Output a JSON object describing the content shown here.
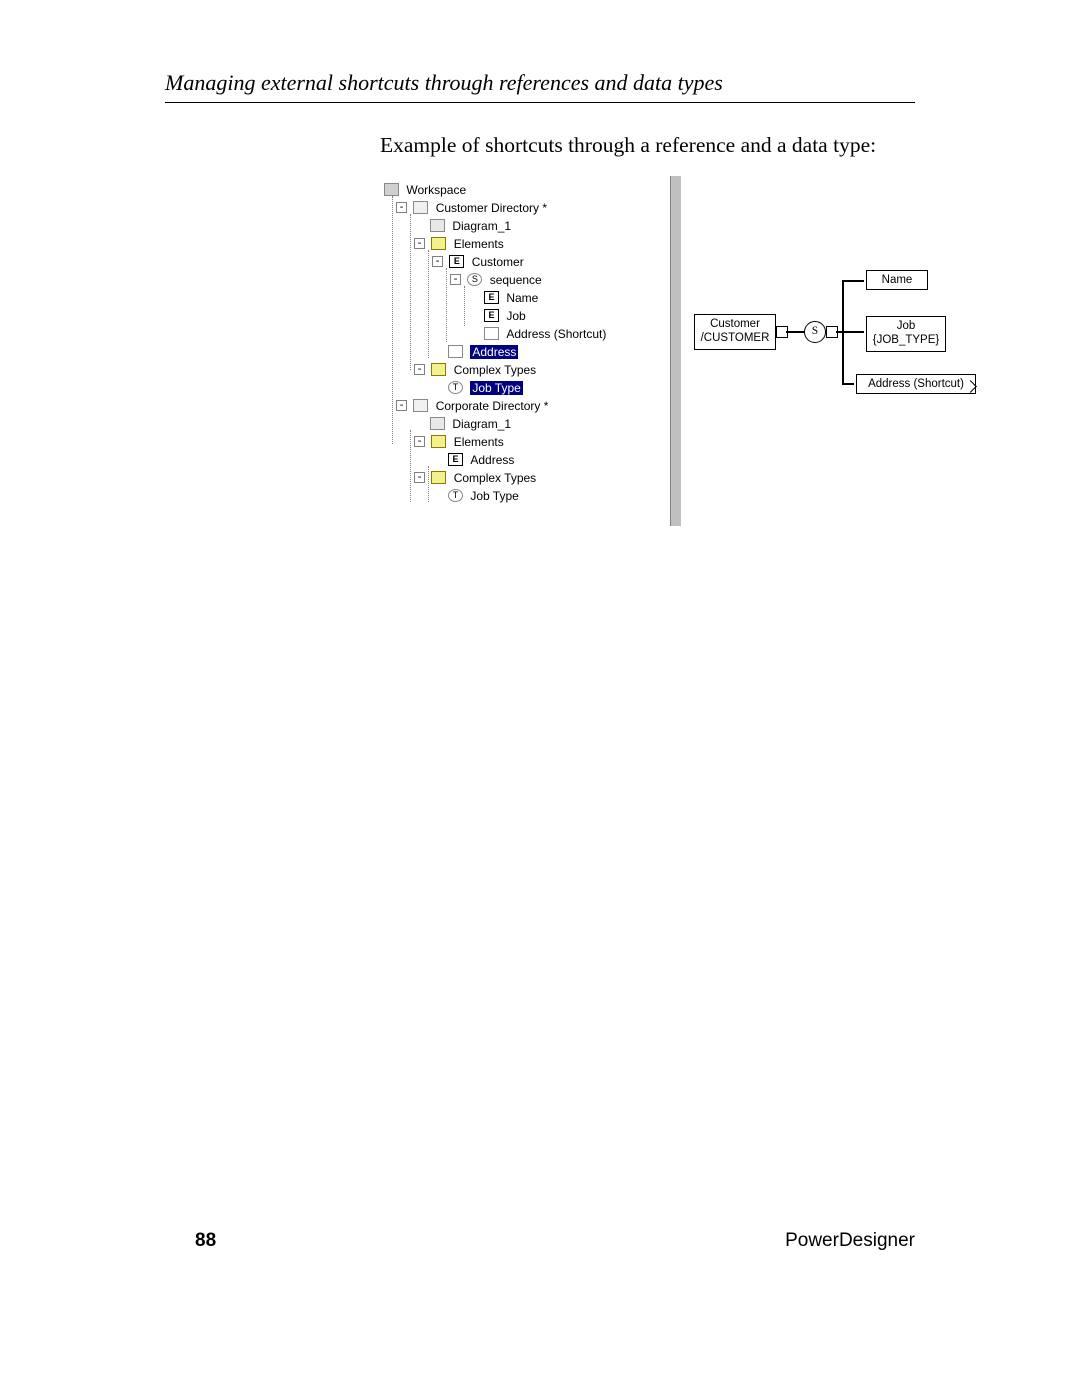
{
  "heading": "Managing external shortcuts through references and data types",
  "example_text": "Example of shortcuts through a reference and a data type:",
  "tree": {
    "workspace": "Workspace",
    "cust_dir": "Customer Directory *",
    "diagram1_a": "Diagram_1",
    "elements_a": "Elements",
    "customer": "Customer",
    "sequence": "sequence",
    "name": "Name",
    "job": "Job",
    "address_sc": "Address (Shortcut)",
    "address_sel": "Address",
    "complex_a": "Complex Types",
    "jobtype_sel": "Job Type",
    "corp_dir": "Corporate Directory *",
    "diagram1_b": "Diagram_1",
    "elements_b": "Elements",
    "address_b": "Address",
    "complex_b": "Complex Types",
    "jobtype_b": "Job Type"
  },
  "diagram": {
    "customer_l1": "Customer",
    "customer_l2": "/CUSTOMER",
    "s": "S",
    "name": "Name",
    "job_l1": "Job",
    "job_l2": "{JOB_TYPE}",
    "addr": "Address (Shortcut)"
  },
  "footer": {
    "page": "88",
    "product": "PowerDesigner"
  }
}
